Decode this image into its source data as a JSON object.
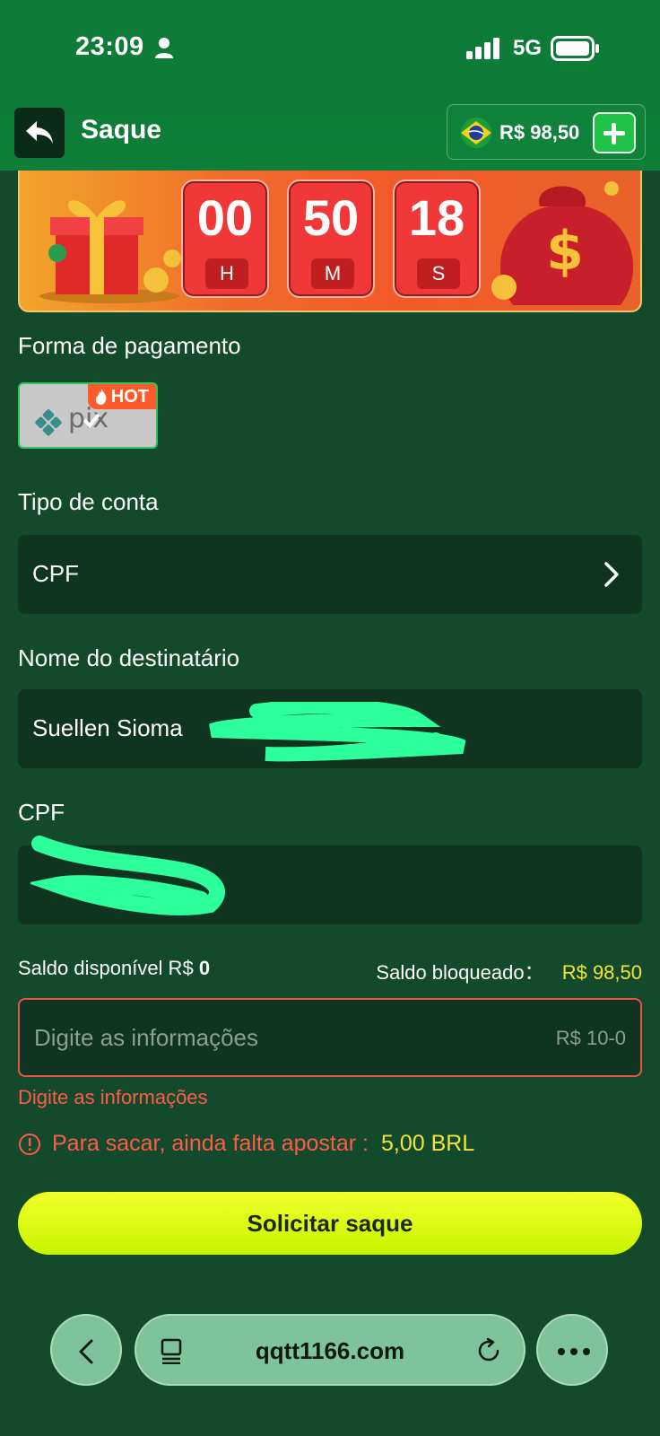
{
  "status_bar": {
    "time": "23:09",
    "network": "5G"
  },
  "header": {
    "title": "Saque",
    "balance": "R$ 98,50",
    "back_icon": "back-arrow-icon",
    "add_icon": "plus-icon"
  },
  "banner": {
    "countdown": [
      {
        "value": "00",
        "unit": "H"
      },
      {
        "value": "50",
        "unit": "M"
      },
      {
        "value": "18",
        "unit": "S"
      }
    ]
  },
  "payment": {
    "label": "Forma de pagamento",
    "method_badge": "HOT"
  },
  "account_type": {
    "label": "Tipo de conta",
    "value": "CPF"
  },
  "recipient": {
    "label": "Nome do destinatário",
    "value": "Suellen Sioma"
  },
  "cpf": {
    "label": "CPF"
  },
  "balances": {
    "available_label": "Saldo disponível R$",
    "available_value": "0",
    "blocked_label": "Saldo bloqueado：",
    "blocked_value": "R$ 98,50"
  },
  "amount": {
    "placeholder": "Digite as informações",
    "range": "R$ 10-0",
    "error": "Digite as informações"
  },
  "warning": {
    "text": "Para sacar, ainda falta apostar :",
    "amount": "5,00 BRL"
  },
  "submit": {
    "label": "Solicitar saque"
  },
  "browser": {
    "url": "qqtt1166.com"
  },
  "colors": {
    "background": "#134a2b",
    "header": "#0f7e39",
    "accent_yellow": "#f5e23a",
    "error_red": "#ff5a4a",
    "button_lime": "#e6ff1a"
  }
}
